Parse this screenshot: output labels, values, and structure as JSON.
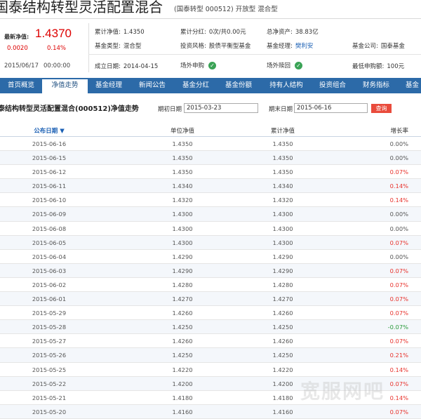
{
  "header": {
    "fund_name": "国泰结构转型灵活配置混合",
    "meta": "(国泰转型 000512) 开放型 混合型"
  },
  "summary": {
    "nav_label": "最新净值:",
    "nav_value": "1.4370",
    "nav_change": "0.0020",
    "nav_change_pct": "0.14%",
    "date": "2015/06/17",
    "time": "00:00:00"
  },
  "details": {
    "acc_nav_label": "累计净值:",
    "acc_nav": "1.4350",
    "dividend_label": "累计分红:",
    "dividend": "0次/共0.00元",
    "assets_label": "总净资产:",
    "assets": "38.83亿",
    "type_label": "基金类型:",
    "type": "混合型",
    "style_label": "投资风格:",
    "style": "股债平衡型基金",
    "manager_label": "基金经理:",
    "manager": "樊利安",
    "company_label": "基金公司:",
    "company": "国泰基金",
    "inception_label": "成立日期:",
    "inception": "2014-04-15",
    "purchase_label": "场外申购",
    "redeem_label": "场外赎回",
    "min_label": "最低申购额:",
    "min": "100元"
  },
  "tabs": [
    "首页概览",
    "净值走势",
    "基金经理",
    "新闻公告",
    "基金分红",
    "基金份额",
    "持有人结构",
    "投资组合",
    "财务指标",
    "基金"
  ],
  "active_tab": 1,
  "query": {
    "title": "泰结构转型灵活配置混合(000512)净值走势",
    "start_label": "期初日期",
    "start_value": "2015-03-23",
    "end_label": "期末日期",
    "end_value": "2015-06-16",
    "button": "查询"
  },
  "table": {
    "headers": [
      "公布日期",
      "单位净值",
      "累计净值",
      "增长率"
    ],
    "rows": [
      [
        "2015-06-16",
        "1.4350",
        "1.4350",
        "0.00%"
      ],
      [
        "2015-06-15",
        "1.4350",
        "1.4350",
        "0.00%"
      ],
      [
        "2015-06-12",
        "1.4350",
        "1.4350",
        "0.07%"
      ],
      [
        "2015-06-11",
        "1.4340",
        "1.4340",
        "0.14%"
      ],
      [
        "2015-06-10",
        "1.4320",
        "1.4320",
        "0.14%"
      ],
      [
        "2015-06-09",
        "1.4300",
        "1.4300",
        "0.00%"
      ],
      [
        "2015-06-08",
        "1.4300",
        "1.4300",
        "0.00%"
      ],
      [
        "2015-06-05",
        "1.4300",
        "1.4300",
        "0.07%"
      ],
      [
        "2015-06-04",
        "1.4290",
        "1.4290",
        "0.00%"
      ],
      [
        "2015-06-03",
        "1.4290",
        "1.4290",
        "0.07%"
      ],
      [
        "2015-06-02",
        "1.4280",
        "1.4280",
        "0.07%"
      ],
      [
        "2015-06-01",
        "1.4270",
        "1.4270",
        "0.07%"
      ],
      [
        "2015-05-29",
        "1.4260",
        "1.4260",
        "0.07%"
      ],
      [
        "2015-05-28",
        "1.4250",
        "1.4250",
        "-0.07%"
      ],
      [
        "2015-05-27",
        "1.4260",
        "1.4260",
        "0.07%"
      ],
      [
        "2015-05-26",
        "1.4250",
        "1.4250",
        "0.21%"
      ],
      [
        "2015-05-25",
        "1.4220",
        "1.4220",
        "0.14%"
      ],
      [
        "2015-05-22",
        "1.4200",
        "1.4200",
        "0.07%"
      ],
      [
        "2015-05-21",
        "1.4180",
        "1.4180",
        "0.14%"
      ],
      [
        "2015-05-20",
        "1.4160",
        "1.4160",
        "0.07%"
      ]
    ]
  },
  "colors": {
    "tab_bar": "#2c6aa8",
    "up": "#e8312b",
    "down": "#2a9a3b",
    "nav": "#dd0000"
  },
  "watermark": "宽服网吧"
}
